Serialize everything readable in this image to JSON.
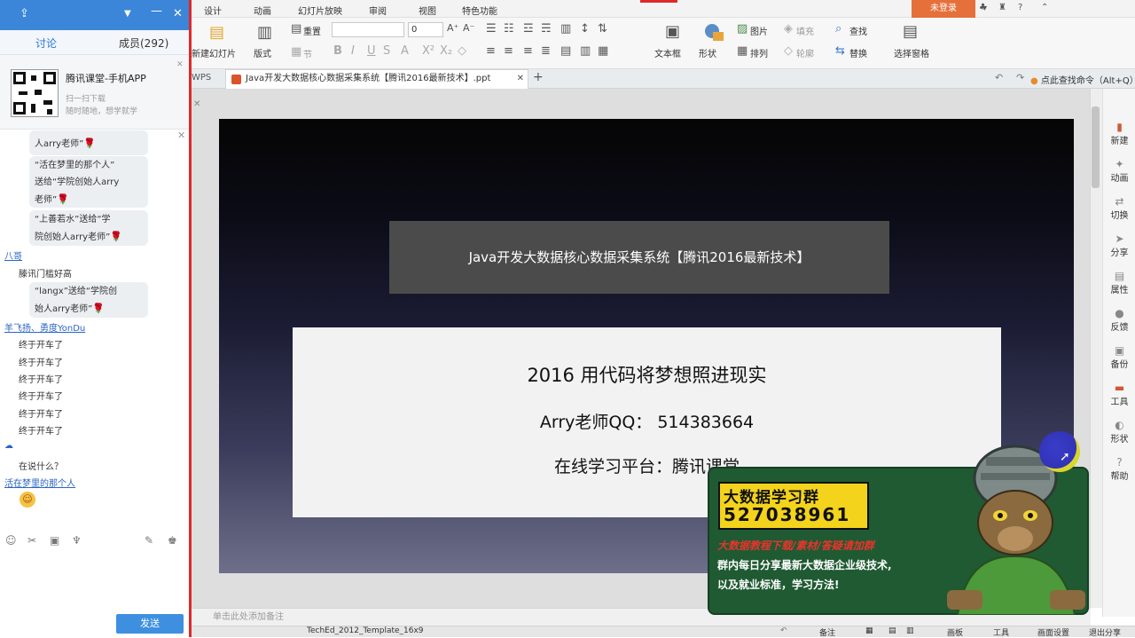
{
  "left_panel": {
    "tabs": {
      "discussion": "讨论",
      "members": "成员(292)"
    },
    "promo": {
      "title": "腾讯课堂-手机APP",
      "line1": "扫一扫下载",
      "line2": "随时随地，想学就学"
    },
    "chat": [
      {
        "type": "bubble",
        "text": "人arry老师”"
      },
      {
        "type": "bubble",
        "text": "“活在梦里的那个人”"
      },
      {
        "type": "bubble",
        "text": "送给“学院创始人arry"
      },
      {
        "type": "bubble",
        "text": "老师”"
      },
      {
        "type": "bubble",
        "text": "“上善若水”送给“学"
      },
      {
        "type": "bubble",
        "text": "院创始人arry老师”"
      },
      {
        "type": "user",
        "text": "八哥"
      },
      {
        "type": "msg",
        "text": "滕讯门槛好高"
      },
      {
        "type": "bubble",
        "text": "“langx”送给“学院创"
      },
      {
        "type": "bubble",
        "text": "始人arry老师”"
      },
      {
        "type": "user",
        "text": "羊飞扬、勇度YonDu"
      },
      {
        "type": "msg",
        "text": "终于开车了"
      },
      {
        "type": "msg",
        "text": "在说什么？"
      },
      {
        "type": "user",
        "text": "活在梦里的那个人"
      }
    ],
    "send_label": "发送"
  },
  "menu": {
    "items": [
      "设计",
      "动画",
      "幻灯片放映",
      "审阅",
      "视图",
      "特色功能"
    ],
    "login": "未登录"
  },
  "ribbon": {
    "new_slide": "新建幻灯片",
    "layout": "版式",
    "reset": "重置",
    "section": "节",
    "font_size": "0",
    "text_box": "文本框",
    "shape": "形状",
    "picture": "图片",
    "fill": "填充",
    "arrange": "排列",
    "outline": "轮廓",
    "find": "查找",
    "replace": "替换",
    "select_pane": "选择窗格"
  },
  "tabs": {
    "wps": "WPS",
    "doc": "Java开发大数据核心数据采集系统【腾讯2016最新技术】.ppt",
    "search": "点此查找命令（Alt+Q）"
  },
  "slide": {
    "title": "Java开发大数据核心数据采集系统【腾讯2016最新技术】",
    "line1": "2016 用代码将梦想照进现实",
    "line2": "Arry老师QQ：  514383664",
    "line3": "在线学习平台：腾讯课堂"
  },
  "ad": {
    "title": "大数据学习群",
    "number": "527038961",
    "line1": "大数据教程下载/素材/答疑请加群",
    "line2": "群内每日分享最新大数据企业级技术,",
    "line3": "以及就业标准，学习方法!"
  },
  "right_sidebar": [
    "新建",
    "动画",
    "切换",
    "分享",
    "属性",
    "反馈",
    "备份",
    "工具",
    "形状",
    "帮助"
  ],
  "notes_placeholder": "单击此处添加备注",
  "status": {
    "template": "TechEd_2012_Template_16x9",
    "notes": "备注",
    "board": "画板",
    "tools": "工具",
    "screen_settings": "画面设置",
    "exit_share": "退出分享"
  },
  "colors": {
    "accent_red": "#e0282a",
    "qq_blue": "#3b86d8",
    "ad_yellow": "#f3d31c",
    "ad_red": "#e8342d"
  }
}
